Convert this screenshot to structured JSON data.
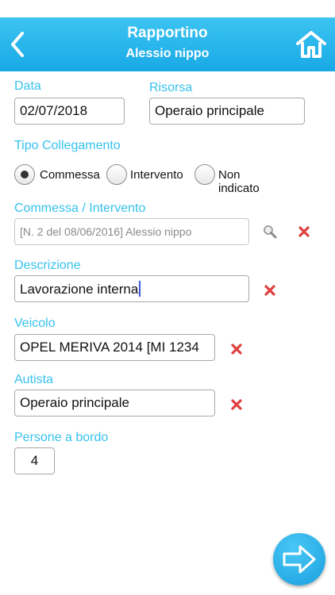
{
  "header": {
    "title": "Rapportino",
    "subtitle": "Alessio nippo",
    "back_icon": "chevron-left-icon",
    "home_icon": "home-icon",
    "color": "#1fb0ea"
  },
  "form": {
    "data": {
      "label": "Data",
      "value": "02/07/2018"
    },
    "risorsa": {
      "label": "Risorsa",
      "value": "Operaio principale"
    },
    "tipo_collegamento": {
      "label": "Tipo Collegamento",
      "options": [
        "Commessa",
        "Intervento",
        "Non indicato"
      ],
      "selected": "Commessa"
    },
    "commessa_intervento": {
      "label": "Commessa / Intervento",
      "value": "[N. 2 del 08/06/2016] Alessio nippo"
    },
    "descrizione": {
      "label": "Descrizione",
      "value": "Lavorazione interna"
    },
    "veicolo": {
      "label": "Veicolo",
      "value": "OPEL MERIVA 2014 [MI 1234"
    },
    "autista": {
      "label": "Autista",
      "value": "Operaio principale"
    },
    "persone_a_bordo": {
      "label": "Persone a bordo",
      "value": "4"
    }
  },
  "actions": {
    "next_icon": "arrow-right-icon"
  },
  "colors": {
    "accent": "#36c2ee",
    "delete": "#e0403f"
  }
}
